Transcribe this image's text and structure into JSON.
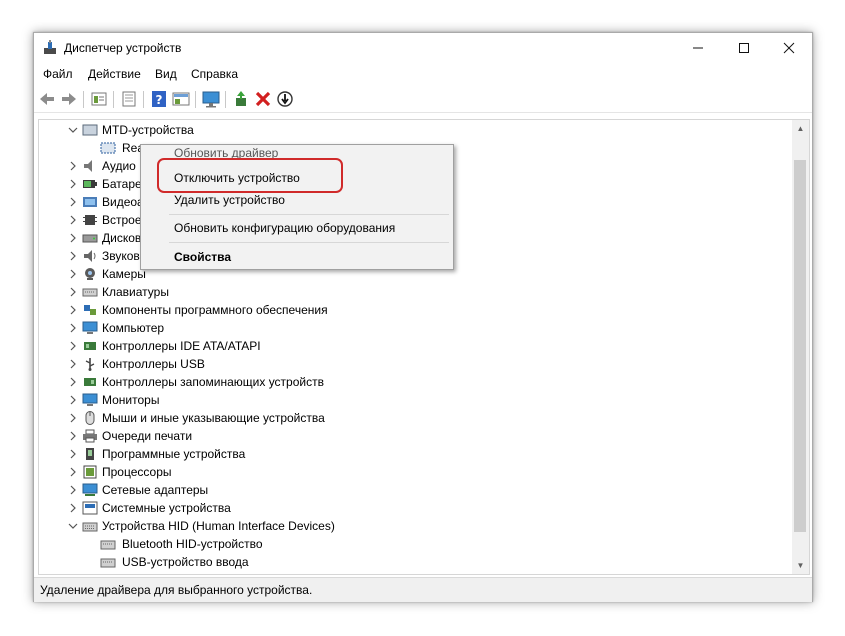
{
  "window": {
    "title": "Диспетчер устройств"
  },
  "menubar": {
    "file": "Файл",
    "action": "Действие",
    "view": "Вид",
    "help": "Справка"
  },
  "toolbar": {
    "icons": [
      "back-icon",
      "forward-icon",
      "properties-icon",
      "show-hide-icon",
      "help-icon",
      "show-view-icon",
      "monitor-icon",
      "update-driver-icon",
      "uninstall-icon",
      "enable-icon"
    ],
    "uninstall_color": "#d21f1f"
  },
  "tree": {
    "root": {
      "label": "MTD-устройства"
    },
    "root_child": {
      "label": "Rea"
    },
    "truncated": [
      {
        "label": "Аудио"
      },
      {
        "label": "Батаре"
      },
      {
        "label": "Видеоа"
      },
      {
        "label": "Встрое"
      },
      {
        "label": "Дисков"
      },
      {
        "label": "Звуков"
      }
    ],
    "categories": [
      {
        "label": "Камеры"
      },
      {
        "label": "Клавиатуры"
      },
      {
        "label": "Компоненты программного обеспечения"
      },
      {
        "label": "Компьютер"
      },
      {
        "label": "Контроллеры IDE ATA/ATAPI"
      },
      {
        "label": "Контроллеры USB"
      },
      {
        "label": "Контроллеры запоминающих устройств"
      },
      {
        "label": "Мониторы"
      },
      {
        "label": "Мыши и иные указывающие устройства"
      },
      {
        "label": "Очереди печати"
      },
      {
        "label": "Программные устройства"
      },
      {
        "label": "Процессоры"
      },
      {
        "label": "Сетевые адаптеры"
      },
      {
        "label": "Системные устройства"
      },
      {
        "label": "Устройства HID (Human Interface Devices)"
      }
    ],
    "hid_children": [
      {
        "label": "Bluetooth HID-устройство"
      },
      {
        "label": "USB-устройство ввода"
      }
    ]
  },
  "context_menu": {
    "update_driver": "Обновить драйвер",
    "disable_device": "Отключить устройство",
    "uninstall_device": "Удалить устройство",
    "scan_hardware": "Обновить конфигурацию оборудования",
    "properties": "Свойства"
  },
  "status": {
    "text": "Удаление драйвера для выбранного устройства."
  },
  "colors": {
    "highlight": "#d02a2a"
  }
}
